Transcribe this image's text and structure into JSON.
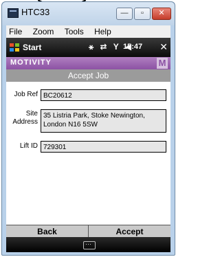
{
  "window": {
    "title": "HTC33",
    "buttons": [
      "minimize",
      "maximize",
      "close"
    ]
  },
  "menu": {
    "items": [
      {
        "label": "File"
      },
      {
        "label": "Zoom"
      },
      {
        "label": "Tools"
      },
      {
        "label": "Help"
      }
    ]
  },
  "status": {
    "start_label": "Start",
    "icons": "⚹ ⇄ Y ◀",
    "clock": "15:47",
    "close_glyph": "✕"
  },
  "brand": {
    "name": "MOTIVITY",
    "logo_letter": "M"
  },
  "screen": {
    "title": "Accept Job"
  },
  "form": {
    "job_ref_label": "Job Ref",
    "job_ref_value": "BC20612",
    "site_label_1": "Site",
    "site_label_2": "Address",
    "site_address_line1": "35 Listria Park, Stoke Newington,",
    "site_address_line2": "London  N16 5SW",
    "lift_id_label": "Lift ID",
    "lift_id_value": "729301"
  },
  "actions": {
    "back_label": "Back",
    "accept_label": "Accept"
  },
  "colors": {
    "brand_purple": "#8c52a4",
    "header_gray": "#9b9b9b",
    "field_bg": "#e6e6e6"
  }
}
